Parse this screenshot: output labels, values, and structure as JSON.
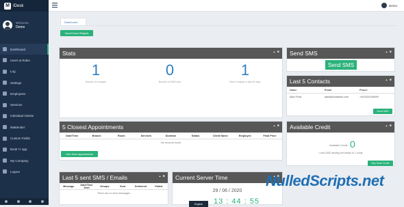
{
  "app": {
    "brand": "IDesk",
    "user_welcome": "Welcome,",
    "user_name": "Demo"
  },
  "topbar": {
    "user": "Demo"
  },
  "sidebar": {
    "items": [
      {
        "label": "Dashboard",
        "icon": "dashboard-icon"
      },
      {
        "label": "Users & Roles",
        "icon": "users-icon"
      },
      {
        "label": "Log",
        "icon": "log-icon"
      },
      {
        "label": "Settings",
        "icon": "gear-icon"
      },
      {
        "label": "Employees",
        "icon": "employees-icon"
      },
      {
        "label": "Services",
        "icon": "services-icon"
      },
      {
        "label": "Individual Clients",
        "icon": "clients-icon"
      },
      {
        "label": "iMattender",
        "icon": "attender-icon"
      },
      {
        "label": "Custom Fields",
        "icon": "fields-icon"
      },
      {
        "label": "Book 'n' app",
        "icon": "book-icon"
      },
      {
        "label": "My Company",
        "icon": "company-icon"
      },
      {
        "label": "Logout",
        "icon": "logout-icon"
      }
    ]
  },
  "breadcrumb": {
    "tab": "Dashboard"
  },
  "open_close_label": "Open/Close Widgets",
  "stats": {
    "title": "Stats",
    "items": [
      {
        "value": "1",
        "label": "Number of contacts"
      },
      {
        "value": "0",
        "label": "Number of SMS sent"
      },
      {
        "value": "1",
        "label": "New Contacts in last 30 days"
      }
    ]
  },
  "send_sms": {
    "title": "Send SMS",
    "button": "Send SMS"
  },
  "last_contacts": {
    "title": "Last 5 Contacts",
    "headers": [
      "Name",
      "Email",
      "Phone"
    ],
    "rows": [
      [
        "Alan Frost",
        "alan@localdesk.com",
        "+447622145399"
      ]
    ],
    "button": "Send SMS"
  },
  "appointments": {
    "title": "5 Closest Appointments",
    "headers": [
      "Date/Time",
      "Branch",
      "Room",
      "Services",
      "Duration",
      "Status",
      "Client Name",
      "Employee",
      "Final Price"
    ],
    "empty": "No records found",
    "button": "View More Appointments"
  },
  "credit": {
    "title": "Available Credit",
    "label": "Available Credit",
    "value": "0",
    "note": "1 sms SMS sending left thanks to 1 credit",
    "button": "Buy More Credit"
  },
  "last_sms": {
    "title": "Last 5 sent SMS / Emails",
    "headers": [
      "Message",
      "Date/Time Sent",
      "Groups",
      "Sent",
      "Delivered",
      "Failed"
    ],
    "empty": "There are no sent messages"
  },
  "server_time": {
    "title": "Current Server Time",
    "date": "29 / 06 / 2020",
    "time": "13 : 44 : 55",
    "lang": "English"
  },
  "watermark": "NulledScripts.net"
}
